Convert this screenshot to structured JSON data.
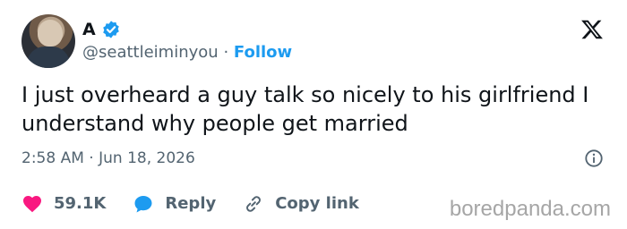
{
  "author": {
    "name": "A",
    "handle": "@seattleiminyou",
    "separator": "·",
    "follow_label": "Follow"
  },
  "tweet": {
    "text": "I just overheard a guy talk so nicely to his girlfriend I understand why people get married",
    "time": "2:58 AM",
    "date_separator": "·",
    "date": "Jun 18, 2026"
  },
  "actions": {
    "likes": "59.1K",
    "reply_label": "Reply",
    "copy_label": "Copy link"
  },
  "watermark": "boredpanda.com",
  "colors": {
    "accent": "#1d9bf0",
    "like": "#f91880",
    "secondary_text": "#536471"
  },
  "icons": [
    "verified-badge-icon",
    "x-logo-icon",
    "info-icon",
    "heart-icon",
    "reply-bubble-icon",
    "link-icon"
  ]
}
